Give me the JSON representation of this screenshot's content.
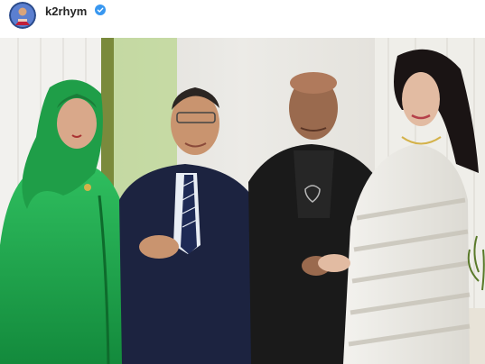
{
  "post": {
    "username": "k2rhym",
    "verified": true,
    "avatar_icon": "profile-avatar",
    "verified_icon": "verified-badge-icon",
    "photo_description_hidden": true
  },
  "colors": {
    "verified_blue": "#3897f0",
    "username_text": "#262626"
  }
}
